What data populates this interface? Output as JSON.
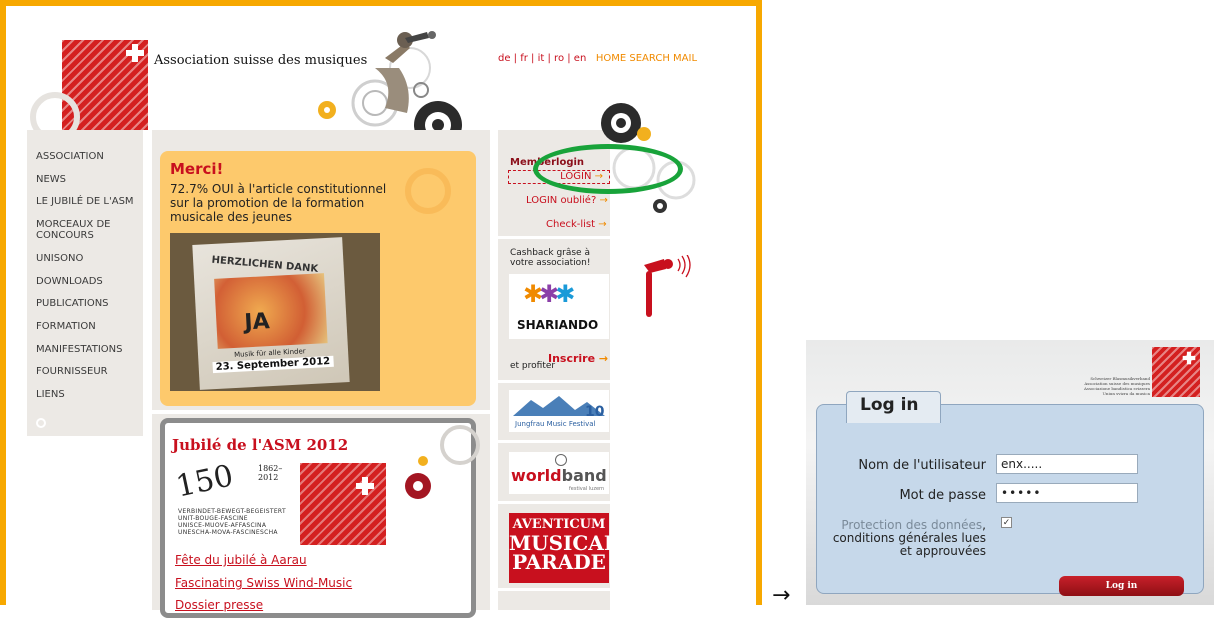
{
  "site": {
    "brand_name": "Association suisse des musiques",
    "languages": [
      "de",
      "fr",
      "it",
      "ro",
      "en"
    ],
    "utility_links": [
      "HOME",
      "SEARCH",
      "MAIL"
    ],
    "nav": [
      "ASSOCIATION",
      "NEWS",
      "LE JUBILÉ DE L'ASM",
      "MORCEAUX DE CONCOURS",
      "UNISONO",
      "DOWNLOADS",
      "PUBLICATIONS",
      "FORMATION",
      "MANIFESTATIONS",
      "FOURNISSEUR",
      "LIENS"
    ],
    "merci": {
      "title": "Merci!",
      "text": "72.7% OUI à l'article constitutionnel sur la promotion de la formation musicale des jeunes",
      "photo_header": "HERZLICHEN DANK",
      "photo_ja": "JA",
      "photo_sub": "Musik für alle Kinder",
      "photo_date": "23. September 2012"
    },
    "jubilee": {
      "title": "Jubilé de l'ASM 2012",
      "logo_number": "150",
      "logo_years": "1862–2012",
      "logo_lines": [
        "VERBINDET-BEWEGT-BEGEISTERT",
        "UNIT-BOUGE-FASCINE",
        "UNISCE-MUOVE-AFFASCINA",
        "UNESCHA-MOVA-FASCINESCHA"
      ],
      "links": [
        "Fête du jubilé à Aarau",
        "Fascinating Swiss Wind-Music",
        "Dossier presse"
      ]
    },
    "member": {
      "title": "Memberlogin",
      "login": "LOGIN",
      "forgot": "LOGIN oublié?",
      "checklist": "Check-list"
    },
    "cashback": {
      "text": "Cashback grâse à votre association!",
      "sponsor": "SHARIANDO",
      "signup": "Inscrire",
      "profit": "et profiter"
    },
    "partners": {
      "jungfrau": "Jungfrau Music Festival",
      "jungfrau_num": "10",
      "worldband_a": "world",
      "worldband_b": "band",
      "worldband_sub": "festival luzern",
      "aventicum": [
        "AVENTICUM",
        "MUSICAL",
        "PARADE"
      ]
    }
  },
  "transition_arrow": "→",
  "login_dialog": {
    "title": "Log in",
    "brand_lines": [
      "Schweizer Blasmusikverband",
      "Association suisse des musiques",
      "Associazione bandistica svizzera",
      "Uniun svizra da musica"
    ],
    "username_label": "Nom de l'utilisateur",
    "username_value": "enx.....",
    "password_label": "Mot de passe",
    "password_value": "•••••",
    "privacy_muted": "Protection des données",
    "privacy_rest": ", conditions générales lues et approuvées",
    "privacy_checked": "✓",
    "submit": "Log in"
  },
  "colors": {
    "frame": "#f7a800",
    "accent": "#c8101e",
    "highlight_ellipse": "#18a33a"
  }
}
